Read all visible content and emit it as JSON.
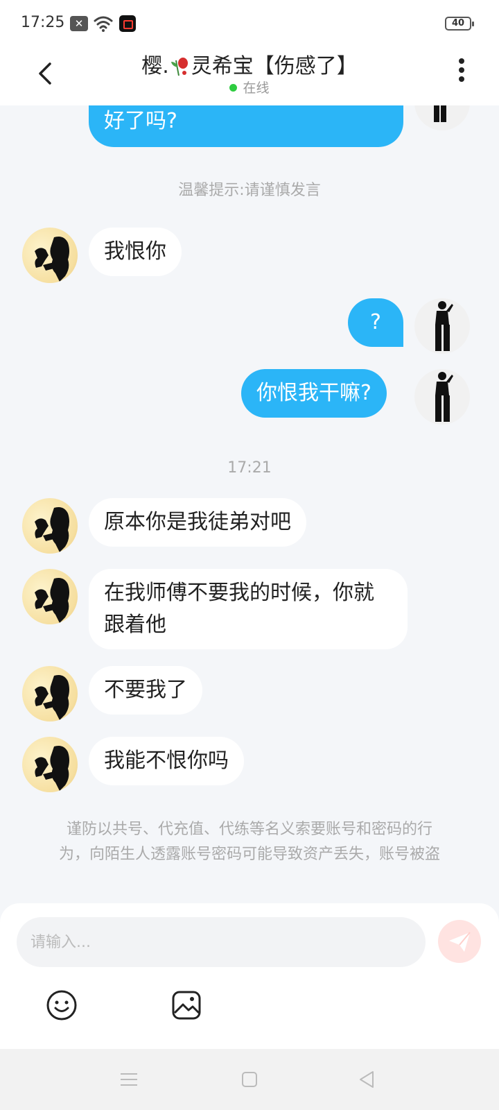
{
  "status_bar": {
    "time": "17:25",
    "battery": "40"
  },
  "header": {
    "title_prefix": "樱.",
    "title_suffix": "灵希宝【伤感了】",
    "status": "在线"
  },
  "messages": {
    "partial_out": "好了吗?",
    "notice": "温馨提示:请谨慎发言",
    "m1": "我恨你",
    "m2": "?",
    "m3": "你恨我干嘛?",
    "timestamp": "17:21",
    "m4": "原本你是我徒弟对吧",
    "m5_line1": "在我师傅不要我的时候，你就",
    "m5_line2": "跟着他",
    "m6": "不要我了",
    "m7": "我能不恨你吗"
  },
  "warning": {
    "line1": "谨防以共号、代充值、代练等名义索要账号和密码的行",
    "line2": "为，向陌生人透露账号密码可能导致资产丢失，账号被盗"
  },
  "input": {
    "placeholder": "请输入..."
  },
  "colors": {
    "accent": "#2bb5f7",
    "background": "#f4f6f9",
    "online": "#2ecc40"
  },
  "icons": [
    "back-arrow-icon",
    "more-dots-icon",
    "send-icon",
    "emoji-icon",
    "image-icon"
  ]
}
